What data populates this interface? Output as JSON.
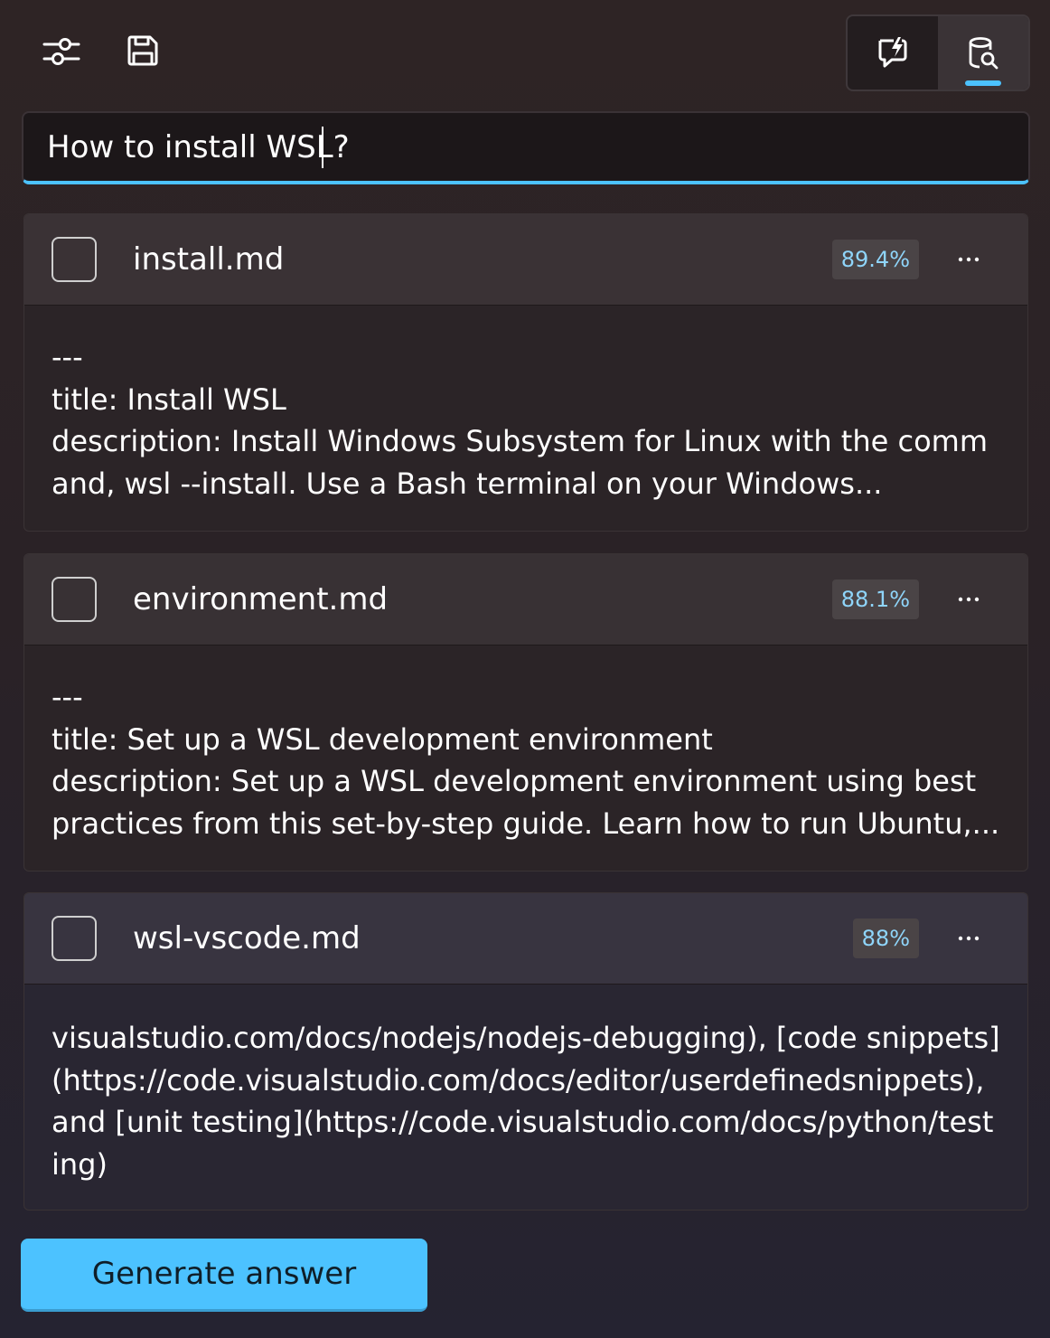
{
  "toolbar": {
    "filters_icon": "sliders-icon",
    "save_icon": "save-icon",
    "modes": [
      {
        "icon": "chat-lightning-icon",
        "selected": false
      },
      {
        "icon": "database-search-icon",
        "selected": true
      }
    ]
  },
  "search": {
    "value": "How to install WSL?"
  },
  "results": [
    {
      "file": "install.md",
      "score": "89.4%",
      "snippet": "---\ntitle: Install WSL\ndescription: Install Windows Subsystem for Linux with the command, wsl --install. Use a Bash terminal on your Windows..."
    },
    {
      "file": "environment.md",
      "score": "88.1%",
      "snippet": "---\ntitle: Set up a WSL development environment\ndescription: Set up a WSL development environment using best practices from this set-by-step guide. Learn how to run Ubuntu,..."
    },
    {
      "file": "wsl-vscode.md",
      "score": "88%",
      "snippet": "visualstudio.com/docs/nodejs/nodejs-debugging), [code snippets](https://code.visualstudio.com/docs/editor/userdefinedsnippets), and [unit testing](https://code.visualstudio.com/docs/python/testing)"
    }
  ],
  "actions": {
    "generate_label": "Generate answer"
  },
  "colors": {
    "accent": "#4cc2ff",
    "score_text": "#8fd5fa"
  }
}
